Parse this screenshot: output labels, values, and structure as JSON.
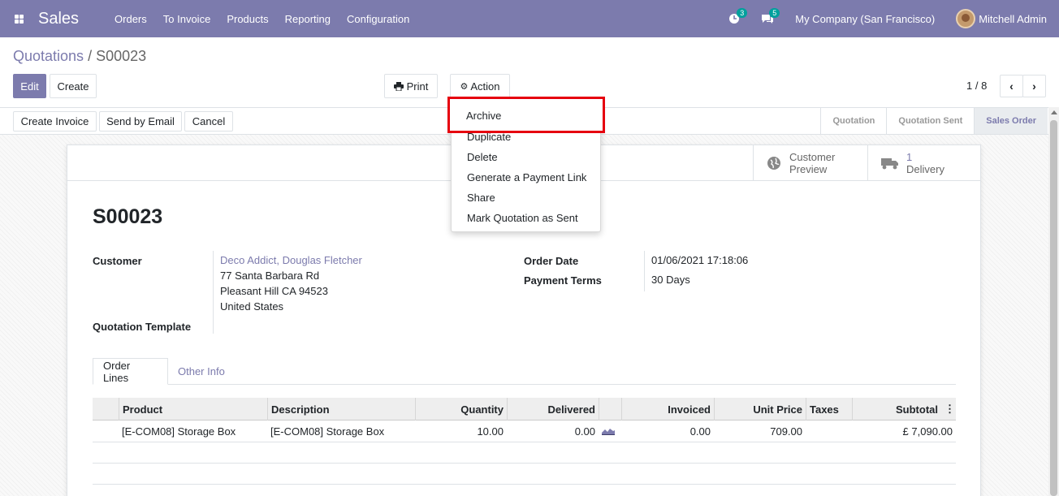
{
  "navbar": {
    "app_name": "Sales",
    "menu": [
      "Orders",
      "To Invoice",
      "Products",
      "Reporting",
      "Configuration"
    ],
    "activity_count": "3",
    "message_count": "5",
    "company": "My Company (San Francisco)",
    "user": "Mitchell Admin",
    "icons": [
      "apps-icon",
      "clock-icon",
      "chat-icon",
      "avatar"
    ]
  },
  "breadcrumb": {
    "parent": "Quotations",
    "separator": " / ",
    "current": "S00023"
  },
  "buttons": {
    "edit": "Edit",
    "create": "Create",
    "print": "Print",
    "action": "Action"
  },
  "pager": {
    "value": "1 / 8"
  },
  "statusbar": {
    "buttons": [
      "Create Invoice",
      "Send by Email",
      "Cancel"
    ],
    "stages": [
      {
        "label": "Quotation",
        "active": false
      },
      {
        "label": "Quotation Sent",
        "active": false
      },
      {
        "label": "Sales Order",
        "active": true
      }
    ]
  },
  "action_menu": {
    "items": [
      "Archive",
      "Duplicate",
      "Delete",
      "Generate a Payment Link",
      "Share",
      "Mark Quotation as Sent"
    ],
    "highlighted": "Archive"
  },
  "smart_buttons": {
    "customer_preview": {
      "line1": "Customer",
      "line2": "Preview"
    },
    "delivery": {
      "count": "1",
      "label": "Delivery"
    }
  },
  "record": {
    "name": "S00023",
    "customer_label": "Customer",
    "customer_name": "Deco Addict, Douglas Fletcher",
    "address": [
      "77 Santa Barbara Rd",
      "Pleasant Hill CA 94523",
      "United States"
    ],
    "template_label": "Quotation Template",
    "order_date_label": "Order Date",
    "order_date": "01/06/2021 17:18:06",
    "payment_terms_label": "Payment Terms",
    "payment_terms": "30 Days"
  },
  "tabs": [
    {
      "label": "Order Lines",
      "active": true
    },
    {
      "label": "Other Info",
      "active": false
    }
  ],
  "order_lines": {
    "columns": [
      "Product",
      "Description",
      "Quantity",
      "Delivered",
      "",
      "Invoiced",
      "Unit Price",
      "Taxes",
      "Subtotal"
    ],
    "rows": [
      {
        "product": "[E-COM08] Storage Box",
        "description": "[E-COM08] Storage Box",
        "quantity": "10.00",
        "delivered": "0.00",
        "invoiced": "0.00",
        "unit_price": "709.00",
        "taxes": "",
        "subtotal": "£ 7,090.00"
      }
    ]
  }
}
